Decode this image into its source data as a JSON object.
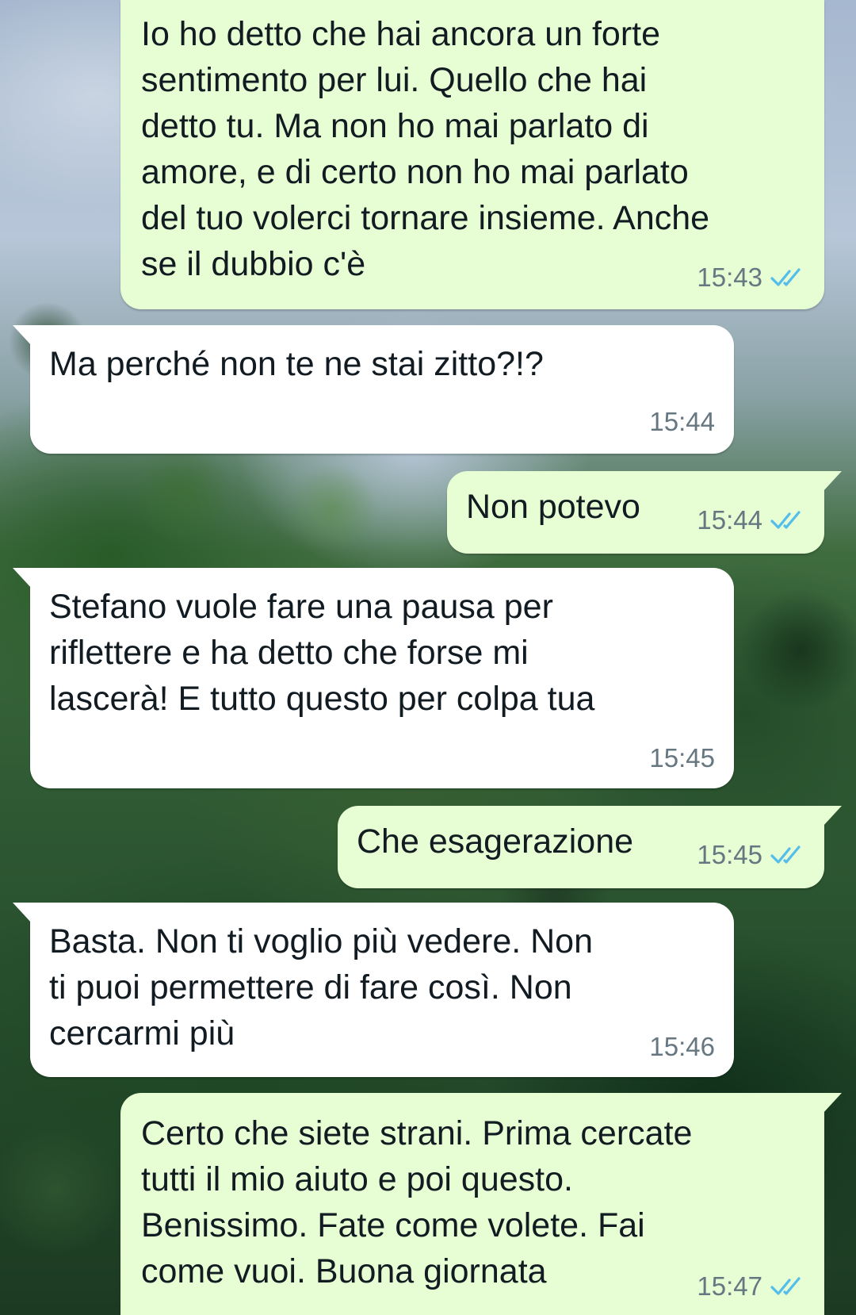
{
  "colors": {
    "outgoing_bubble": "#e7fdd3",
    "incoming_bubble": "#ffffff",
    "timestamp": "#667781",
    "read_ticks": "#53bdeb"
  },
  "messages": [
    {
      "direction": "outgoing",
      "text": "Io ho detto che hai ancora un forte\nsentimento per lui. Quello che hai\ndetto tu. Ma non ho mai parlato di\namore, e di certo non ho mai parlato\ndel tuo volerci tornare insieme. Anche\nse il dubbio c'è",
      "time": "15:43",
      "status_icon": "double-check-read-icon"
    },
    {
      "direction": "incoming",
      "text": "Ma perché non te ne stai zitto?!?",
      "time": "15:44"
    },
    {
      "direction": "outgoing",
      "text": "Non potevo",
      "time": "15:44",
      "status_icon": "double-check-read-icon"
    },
    {
      "direction": "incoming",
      "text": "Stefano vuole fare una pausa per\nriflettere e ha detto che forse mi\nlascerà! E tutto questo per colpa tua",
      "time": "15:45"
    },
    {
      "direction": "outgoing",
      "text": "Che esagerazione",
      "time": "15:45",
      "status_icon": "double-check-read-icon"
    },
    {
      "direction": "incoming",
      "text": "Basta. Non ti voglio più vedere. Non\nti puoi permettere di fare così. Non\ncercarmi più",
      "time": "15:46"
    },
    {
      "direction": "outgoing",
      "text": "Certo che siete strani. Prima cercate\ntutti il mio aiuto e poi questo.\nBenissimo. Fate come volete. Fai\ncome vuoi. Buona giornata",
      "time": "15:47",
      "status_icon": "double-check-read-icon"
    }
  ]
}
